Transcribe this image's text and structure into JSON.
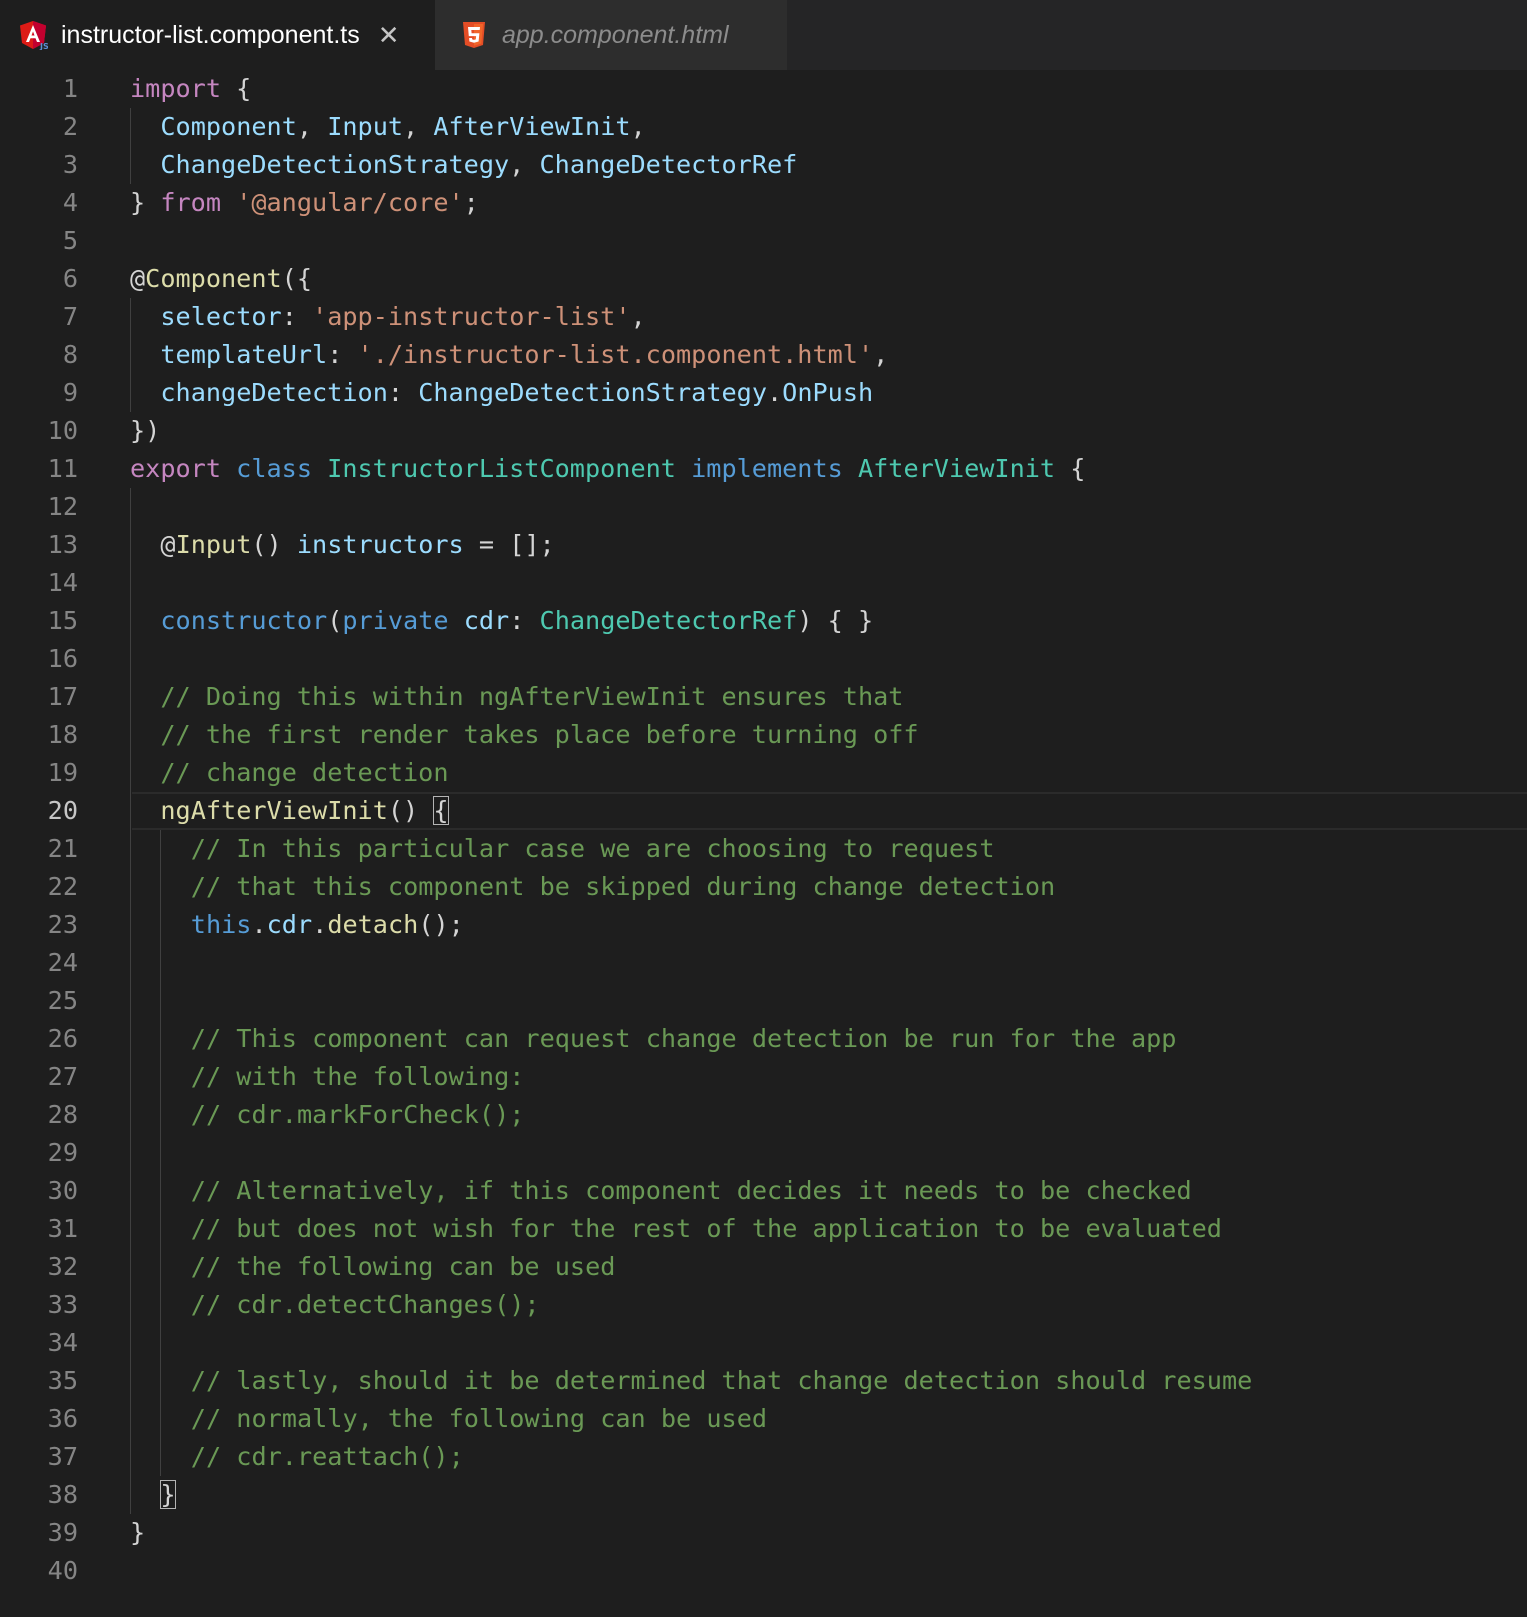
{
  "tabs": [
    {
      "label": "instructor-list.component.ts",
      "icon": "angular-icon",
      "active": true,
      "close_glyph": "✕"
    },
    {
      "label": "app.component.html",
      "icon": "html5-icon",
      "active": false
    }
  ],
  "editor": {
    "current_line": 20,
    "lines": [
      {
        "n": "1",
        "indent": 0,
        "tokens": [
          {
            "t": "import",
            "c": "kw"
          },
          {
            "t": " {",
            "c": "pun"
          }
        ]
      },
      {
        "n": "2",
        "indent": 1,
        "tokens": [
          {
            "t": "Component",
            "c": "var"
          },
          {
            "t": ", ",
            "c": "pun"
          },
          {
            "t": "Input",
            "c": "var"
          },
          {
            "t": ", ",
            "c": "pun"
          },
          {
            "t": "AfterViewInit",
            "c": "var"
          },
          {
            "t": ",",
            "c": "pun"
          }
        ]
      },
      {
        "n": "3",
        "indent": 1,
        "tokens": [
          {
            "t": "ChangeDetectionStrategy",
            "c": "var"
          },
          {
            "t": ", ",
            "c": "pun"
          },
          {
            "t": "ChangeDetectorRef",
            "c": "var"
          }
        ]
      },
      {
        "n": "4",
        "indent": 0,
        "tokens": [
          {
            "t": "} ",
            "c": "pun"
          },
          {
            "t": "from",
            "c": "kw"
          },
          {
            "t": " ",
            "c": "pun"
          },
          {
            "t": "'@angular/core'",
            "c": "str"
          },
          {
            "t": ";",
            "c": "pun"
          }
        ]
      },
      {
        "n": "5",
        "indent": 0,
        "tokens": []
      },
      {
        "n": "6",
        "indent": 0,
        "tokens": [
          {
            "t": "@",
            "c": "pun"
          },
          {
            "t": "Component",
            "c": "fn"
          },
          {
            "t": "({",
            "c": "pun"
          }
        ]
      },
      {
        "n": "7",
        "indent": 1,
        "tokens": [
          {
            "t": "selector",
            "c": "var"
          },
          {
            "t": ": ",
            "c": "pun"
          },
          {
            "t": "'app-instructor-list'",
            "c": "str"
          },
          {
            "t": ",",
            "c": "pun"
          }
        ]
      },
      {
        "n": "8",
        "indent": 1,
        "tokens": [
          {
            "t": "templateUrl",
            "c": "var"
          },
          {
            "t": ": ",
            "c": "pun"
          },
          {
            "t": "'./instructor-list.component.html'",
            "c": "str"
          },
          {
            "t": ",",
            "c": "pun"
          }
        ]
      },
      {
        "n": "9",
        "indent": 1,
        "tokens": [
          {
            "t": "changeDetection",
            "c": "var"
          },
          {
            "t": ": ",
            "c": "pun"
          },
          {
            "t": "ChangeDetectionStrategy",
            "c": "var"
          },
          {
            "t": ".",
            "c": "pun"
          },
          {
            "t": "OnPush",
            "c": "var"
          }
        ]
      },
      {
        "n": "10",
        "indent": 0,
        "tokens": [
          {
            "t": "})",
            "c": "pun"
          }
        ]
      },
      {
        "n": "11",
        "indent": 0,
        "tokens": [
          {
            "t": "export",
            "c": "kw"
          },
          {
            "t": " ",
            "c": "pun"
          },
          {
            "t": "class",
            "c": "st"
          },
          {
            "t": " ",
            "c": "pun"
          },
          {
            "t": "InstructorListComponent",
            "c": "ty"
          },
          {
            "t": " ",
            "c": "pun"
          },
          {
            "t": "implements",
            "c": "st"
          },
          {
            "t": " ",
            "c": "pun"
          },
          {
            "t": "AfterViewInit",
            "c": "ty"
          },
          {
            "t": " {",
            "c": "pun"
          }
        ]
      },
      {
        "n": "12",
        "indent": 1,
        "tokens": []
      },
      {
        "n": "13",
        "indent": 1,
        "tokens": [
          {
            "t": "@",
            "c": "pun"
          },
          {
            "t": "Input",
            "c": "fn"
          },
          {
            "t": "() ",
            "c": "pun"
          },
          {
            "t": "instructors",
            "c": "var"
          },
          {
            "t": " = [];",
            "c": "pun"
          }
        ]
      },
      {
        "n": "14",
        "indent": 1,
        "tokens": []
      },
      {
        "n": "15",
        "indent": 1,
        "tokens": [
          {
            "t": "constructor",
            "c": "st"
          },
          {
            "t": "(",
            "c": "pun"
          },
          {
            "t": "private",
            "c": "st"
          },
          {
            "t": " ",
            "c": "pun"
          },
          {
            "t": "cdr",
            "c": "var"
          },
          {
            "t": ": ",
            "c": "pun"
          },
          {
            "t": "ChangeDetectorRef",
            "c": "ty"
          },
          {
            "t": ") { }",
            "c": "pun"
          }
        ]
      },
      {
        "n": "16",
        "indent": 1,
        "tokens": []
      },
      {
        "n": "17",
        "indent": 1,
        "tokens": [
          {
            "t": "// Doing this within ngAfterViewInit ensures that",
            "c": "com"
          }
        ]
      },
      {
        "n": "18",
        "indent": 1,
        "tokens": [
          {
            "t": "// the first render takes place before turning off",
            "c": "com"
          }
        ]
      },
      {
        "n": "19",
        "indent": 1,
        "tokens": [
          {
            "t": "// change detection",
            "c": "com"
          }
        ]
      },
      {
        "n": "20",
        "indent": 1,
        "tokens": [
          {
            "t": "ngAfterViewInit",
            "c": "fn"
          },
          {
            "t": "() ",
            "c": "pun"
          },
          {
            "t": "{",
            "c": "pun",
            "m": true
          }
        ]
      },
      {
        "n": "21",
        "indent": 2,
        "tokens": [
          {
            "t": "// In this particular case we are choosing to request",
            "c": "com"
          }
        ]
      },
      {
        "n": "22",
        "indent": 2,
        "tokens": [
          {
            "t": "// that this component be skipped during change detection",
            "c": "com"
          }
        ]
      },
      {
        "n": "23",
        "indent": 2,
        "tokens": [
          {
            "t": "this",
            "c": "st"
          },
          {
            "t": ".",
            "c": "pun"
          },
          {
            "t": "cdr",
            "c": "var"
          },
          {
            "t": ".",
            "c": "pun"
          },
          {
            "t": "detach",
            "c": "fn"
          },
          {
            "t": "();",
            "c": "pun"
          }
        ]
      },
      {
        "n": "24",
        "indent": 2,
        "tokens": []
      },
      {
        "n": "25",
        "indent": 2,
        "tokens": []
      },
      {
        "n": "26",
        "indent": 2,
        "tokens": [
          {
            "t": "// This component can request change detection be run for the app",
            "c": "com"
          }
        ]
      },
      {
        "n": "27",
        "indent": 2,
        "tokens": [
          {
            "t": "// with the following:",
            "c": "com"
          }
        ]
      },
      {
        "n": "28",
        "indent": 2,
        "tokens": [
          {
            "t": "// cdr.markForCheck();",
            "c": "com"
          }
        ]
      },
      {
        "n": "29",
        "indent": 2,
        "tokens": []
      },
      {
        "n": "30",
        "indent": 2,
        "tokens": [
          {
            "t": "// Alternatively, if this component decides it needs to be checked",
            "c": "com"
          }
        ]
      },
      {
        "n": "31",
        "indent": 2,
        "tokens": [
          {
            "t": "// but does not wish for the rest of the application to be evaluated",
            "c": "com"
          }
        ]
      },
      {
        "n": "32",
        "indent": 2,
        "tokens": [
          {
            "t": "// the following can be used",
            "c": "com"
          }
        ]
      },
      {
        "n": "33",
        "indent": 2,
        "tokens": [
          {
            "t": "// cdr.detectChanges();",
            "c": "com"
          }
        ]
      },
      {
        "n": "34",
        "indent": 2,
        "tokens": []
      },
      {
        "n": "35",
        "indent": 2,
        "tokens": [
          {
            "t": "// lastly, should it be determined that change detection should resume",
            "c": "com"
          }
        ]
      },
      {
        "n": "36",
        "indent": 2,
        "tokens": [
          {
            "t": "// normally, the following can be used",
            "c": "com"
          }
        ]
      },
      {
        "n": "37",
        "indent": 2,
        "tokens": [
          {
            "t": "// cdr.reattach();",
            "c": "com"
          }
        ]
      },
      {
        "n": "38",
        "indent": 1,
        "tokens": [
          {
            "t": "}",
            "c": "pun",
            "m": true
          }
        ]
      },
      {
        "n": "39",
        "indent": 0,
        "tokens": [
          {
            "t": "}",
            "c": "pun"
          }
        ]
      },
      {
        "n": "40",
        "indent": 0,
        "tokens": []
      }
    ]
  }
}
